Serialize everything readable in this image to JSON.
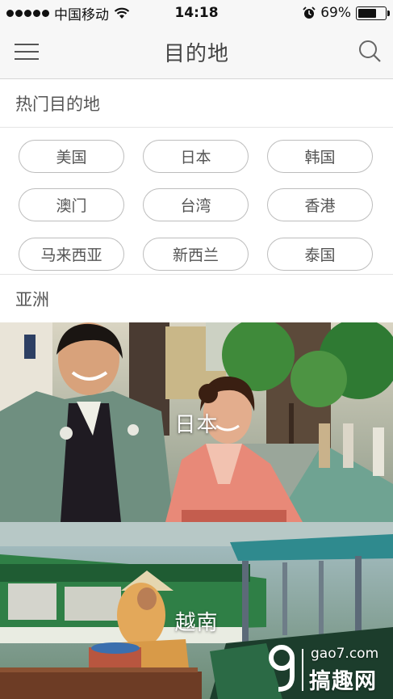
{
  "status_bar": {
    "carrier": "中国移动",
    "time": "14:18",
    "battery_percent": "69%",
    "battery_level": 0.69,
    "icons": [
      "signal-dots-icon",
      "wifi-icon",
      "alarm-clock-icon",
      "battery-icon"
    ]
  },
  "nav": {
    "title": "目的地",
    "left_icon": "menu-icon",
    "right_icon": "search-icon"
  },
  "hot": {
    "title": "热门目的地",
    "tags": [
      "美国",
      "日本",
      "韩国",
      "澳门",
      "台湾",
      "香港",
      "马来西亚",
      "新西兰",
      "泰国"
    ]
  },
  "asia": {
    "title": "亚洲",
    "cards": [
      {
        "label": "日本"
      },
      {
        "label": "越南"
      }
    ]
  },
  "watermark": {
    "domain": "gao7.com",
    "name": "搞趣网"
  },
  "colors": {
    "bar_bg": "#f7f7f7",
    "border": "#bdbdbd",
    "text": "#555555"
  }
}
